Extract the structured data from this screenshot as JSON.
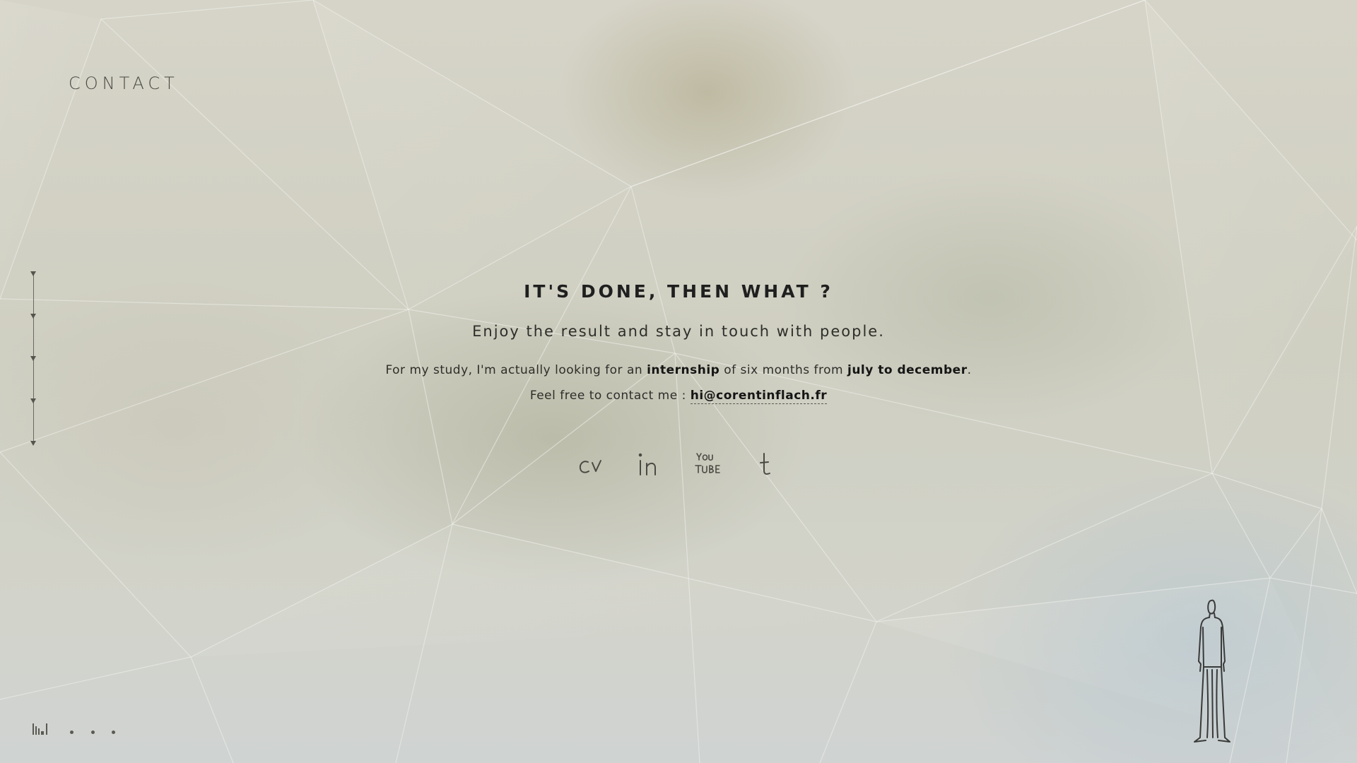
{
  "page": {
    "section_title": "CONTACT"
  },
  "content": {
    "heading": "IT'S DONE, THEN WHAT ?",
    "lead": "Enjoy the result and stay in touch with people.",
    "para1_before": "For my study, I'm actually looking for an ",
    "para1_bold1": "internship",
    "para1_middle": " of six months from ",
    "para1_bold2": "july to december",
    "para1_after": ".",
    "para2_before": "Feel free to contact me : ",
    "email": "hi@corentinflach.fr"
  },
  "socials": [
    {
      "label": "cv",
      "icon": "cv-icon"
    },
    {
      "label": "in",
      "icon": "linkedin-icon"
    },
    {
      "label": "YOU TUBE",
      "icon": "youtube-icon"
    },
    {
      "label": "t",
      "icon": "tumblr-icon"
    }
  ],
  "navigation": {
    "section_markers": 5,
    "bottom_dots": 3
  },
  "colors": {
    "text": "#2b2b2b",
    "heading": "#1f1f1f",
    "background": "#d3d3c6",
    "mesh_lines": "#f2f2ec"
  }
}
